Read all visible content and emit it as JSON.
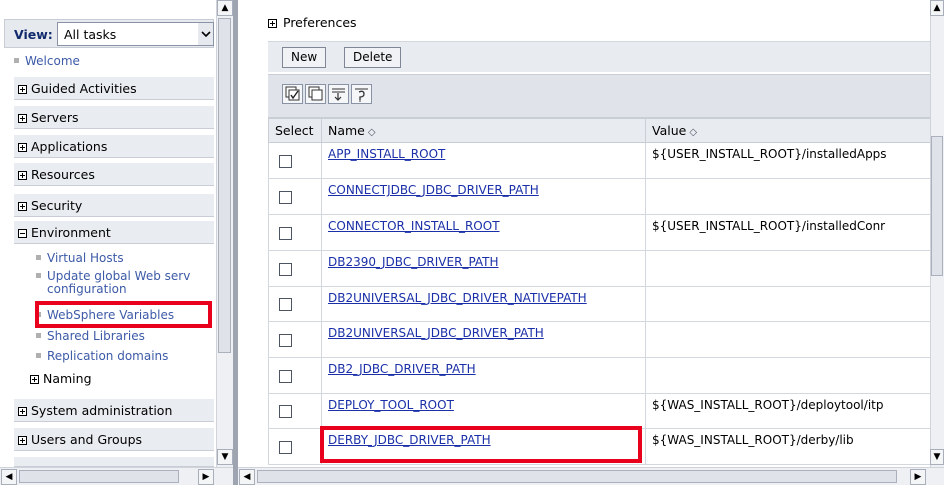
{
  "nav": {
    "view_label": "View:",
    "view_value": "All tasks",
    "welcome": "Welcome",
    "groups": [
      {
        "label": "Guided Activities",
        "expanded": false
      },
      {
        "label": "Servers",
        "expanded": false
      },
      {
        "label": "Applications",
        "expanded": false
      },
      {
        "label": "Resources",
        "expanded": false
      },
      {
        "label": "Security",
        "expanded": false
      },
      {
        "label": "Environment",
        "expanded": true
      },
      {
        "label": "System administration",
        "expanded": false
      },
      {
        "label": "Users and Groups",
        "expanded": false
      }
    ],
    "environment_items": [
      "Virtual Hosts",
      "Update global Web serv",
      "configuration",
      "WebSphere Variables",
      "Shared Libraries",
      "Replication domains"
    ],
    "naming_label": "Naming"
  },
  "main": {
    "preferences_label": "Preferences",
    "buttons": {
      "new": "New",
      "delete": "Delete"
    },
    "icons": [
      "select-all-icon",
      "deselect-all-icon",
      "show-filter-icon",
      "clear-filter-icon"
    ],
    "table": {
      "headers": {
        "select": "Select",
        "name": "Name",
        "value": "Value"
      },
      "rows": [
        {
          "name": "APP_INSTALL_ROOT",
          "value": "${USER_INSTALL_ROOT}/installedApps"
        },
        {
          "name": "CONNECTJDBC_JDBC_DRIVER_PATH",
          "value": ""
        },
        {
          "name": "CONNECTOR_INSTALL_ROOT",
          "value": "${USER_INSTALL_ROOT}/installedConr"
        },
        {
          "name": "DB2390_JDBC_DRIVER_PATH",
          "value": ""
        },
        {
          "name": "DB2UNIVERSAL_JDBC_DRIVER_NATIVEPATH",
          "value": ""
        },
        {
          "name": "DB2UNIVERSAL_JDBC_DRIVER_PATH",
          "value": ""
        },
        {
          "name": "DB2_JDBC_DRIVER_PATH",
          "value": ""
        },
        {
          "name": "DEPLOY_TOOL_ROOT",
          "value": "${WAS_INSTALL_ROOT}/deploytool/itp"
        },
        {
          "name": "DERBY_JDBC_DRIVER_PATH",
          "value": "${WAS_INSTALL_ROOT}/derby/lib"
        }
      ]
    }
  },
  "colors": {
    "highlight": "#e8001c",
    "link": "#1a2fa8",
    "nav_link": "#3c5aa7"
  }
}
